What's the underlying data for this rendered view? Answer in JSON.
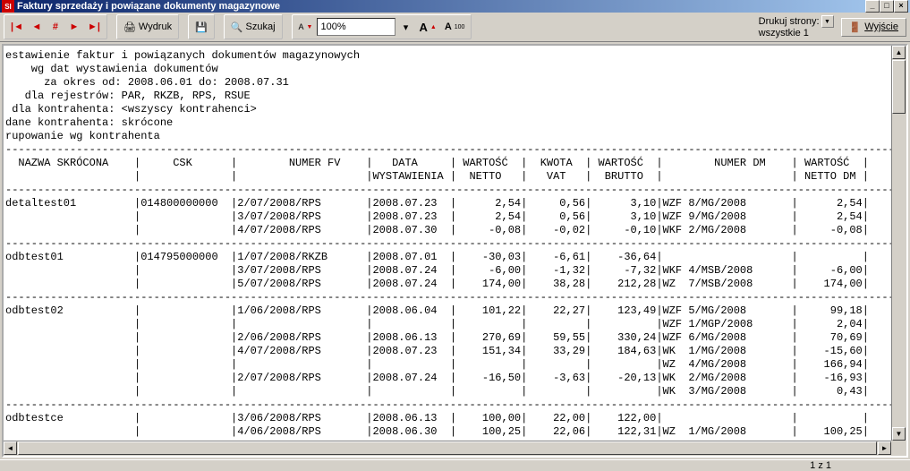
{
  "window": {
    "title": "Faktury sprzedaży i powiązane dokumenty magazynowe"
  },
  "toolbar": {
    "print_label": "Wydruk",
    "search_label": "Szukaj",
    "zoom_value": "100%",
    "print_pages_label": "Drukuj strony:",
    "print_pages_value": "wszystkie 1",
    "exit_label": "Wyjście"
  },
  "status": {
    "page": "1 z 1"
  },
  "chart_data": {
    "type": "table",
    "report_title": "estawienie faktur i powiązanych dokumentów magazynowych",
    "params": {
      "wg_dat": "wg dat wystawienia dokumentów",
      "okres": "za okres od: 2008.06.01 do: 2008.07.31",
      "rejestry": "dla rejestrów: PAR, RKZB, RPS, RSUE",
      "kontrahent": "dla kontrahenta: <wszyscy kontrahenci>",
      "dane_kontrahenta": "dane kontrahenta: skrócone",
      "grupowanie": "rupowanie wg kontrahenta"
    },
    "columns": [
      "NAZWA SKRÓCONA",
      "CSK",
      "NUMER FV",
      "DATA WYSTAWIENIA",
      "WARTOŚĆ NETTO",
      "KWOTA VAT",
      "WARTOŚĆ BRUTTO",
      "NUMER DM",
      "WARTOŚĆ NETTO DM"
    ],
    "groups": [
      {
        "name": "detaltest01",
        "csk": "014800000000",
        "rows": [
          {
            "fv": "2/07/2008/RPS",
            "data": "2008.07.23",
            "netto": "2,54",
            "vat": "0,56",
            "brutto": "3,10",
            "dm": "WZF 8/MG/2008",
            "netto_dm": "2,54"
          },
          {
            "fv": "3/07/2008/RPS",
            "data": "2008.07.23",
            "netto": "2,54",
            "vat": "0,56",
            "brutto": "3,10",
            "dm": "WZF 9/MG/2008",
            "netto_dm": "2,54"
          },
          {
            "fv": "4/07/2008/RPS",
            "data": "2008.07.30",
            "netto": "-0,08",
            "vat": "-0,02",
            "brutto": "-0,10",
            "dm": "WKF 2/MG/2008",
            "netto_dm": "-0,08"
          }
        ]
      },
      {
        "name": "odbtest01",
        "csk": "014795000000",
        "rows": [
          {
            "fv": "1/07/2008/RKZB",
            "data": "2008.07.01",
            "netto": "-30,03",
            "vat": "-6,61",
            "brutto": "-36,64",
            "dm": "",
            "netto_dm": ""
          },
          {
            "fv": "3/07/2008/RPS",
            "data": "2008.07.24",
            "netto": "-6,00",
            "vat": "-1,32",
            "brutto": "-7,32",
            "dm": "WKF 4/MSB/2008",
            "netto_dm": "-6,00"
          },
          {
            "fv": "5/07/2008/RPS",
            "data": "2008.07.24",
            "netto": "174,00",
            "vat": "38,28",
            "brutto": "212,28",
            "dm": "WZ  7/MSB/2008",
            "netto_dm": "174,00"
          }
        ]
      },
      {
        "name": "odbtest02",
        "csk": "",
        "rows": [
          {
            "fv": "1/06/2008/RPS",
            "data": "2008.06.04",
            "netto": "101,22",
            "vat": "22,27",
            "brutto": "123,49",
            "dm": "WZF 5/MG/2008",
            "netto_dm": "99,18"
          },
          {
            "fv": "",
            "data": "",
            "netto": "",
            "vat": "",
            "brutto": "",
            "dm": "WZF 1/MGP/2008",
            "netto_dm": "2,04"
          },
          {
            "fv": "2/06/2008/RPS",
            "data": "2008.06.13",
            "netto": "270,69",
            "vat": "59,55",
            "brutto": "330,24",
            "dm": "WZF 6/MG/2008",
            "netto_dm": "70,69"
          },
          {
            "fv": "4/07/2008/RPS",
            "data": "2008.07.23",
            "netto": "151,34",
            "vat": "33,29",
            "brutto": "184,63",
            "dm": "WK  1/MG/2008",
            "netto_dm": "-15,60"
          },
          {
            "fv": "",
            "data": "",
            "netto": "",
            "vat": "",
            "brutto": "",
            "dm": "WZ  4/MG/2008",
            "netto_dm": "166,94"
          },
          {
            "fv": "2/07/2008/RPS",
            "data": "2008.07.24",
            "netto": "-16,50",
            "vat": "-3,63",
            "brutto": "-20,13",
            "dm": "WK  2/MG/2008",
            "netto_dm": "-16,93"
          },
          {
            "fv": "",
            "data": "",
            "netto": "",
            "vat": "",
            "brutto": "",
            "dm": "WK  3/MG/2008",
            "netto_dm": "0,43"
          }
        ]
      },
      {
        "name": "odbtestce",
        "csk": "",
        "rows": [
          {
            "fv": "3/06/2008/RPS",
            "data": "2008.06.13",
            "netto": "100,00",
            "vat": "22,00",
            "brutto": "122,00",
            "dm": "",
            "netto_dm": ""
          },
          {
            "fv": "4/06/2008/RPS",
            "data": "2008.06.30",
            "netto": "100,25",
            "vat": "22,06",
            "brutto": "122,31",
            "dm": "WZ  1/MG/2008",
            "netto_dm": "100,25"
          }
        ]
      }
    ]
  }
}
